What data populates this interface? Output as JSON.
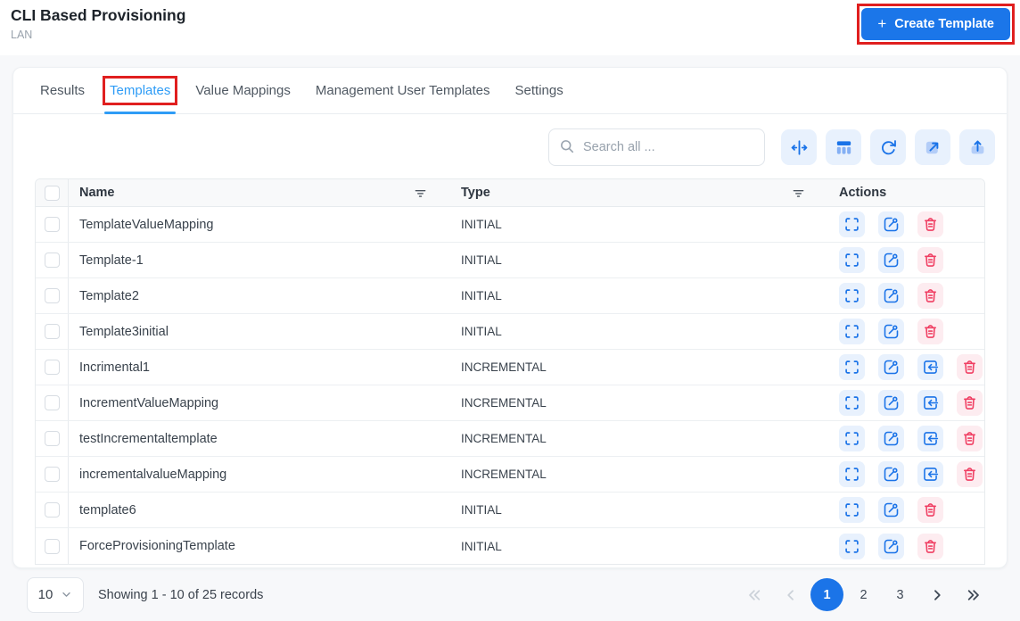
{
  "header": {
    "title": "CLI Based Provisioning",
    "subtitle": "LAN",
    "create_button": {
      "plus": "+",
      "label": "Create Template"
    }
  },
  "tabs": [
    {
      "label": "Results",
      "active": false,
      "annotated": false
    },
    {
      "label": "Templates",
      "active": true,
      "annotated": true
    },
    {
      "label": "Value Mappings",
      "active": false,
      "annotated": false
    },
    {
      "label": "Management User Templates",
      "active": false,
      "annotated": false
    },
    {
      "label": "Settings",
      "active": false,
      "annotated": false
    }
  ],
  "toolbar": {
    "search_placeholder": "Search all ...",
    "buttons": [
      {
        "icon": "column-resize-icon"
      },
      {
        "icon": "columns-icon"
      },
      {
        "icon": "refresh-icon"
      },
      {
        "icon": "open-external-icon"
      },
      {
        "icon": "upload-icon"
      }
    ]
  },
  "table": {
    "headers": {
      "name": "Name",
      "type": "Type",
      "actions": "Actions"
    },
    "rows": [
      {
        "name": "TemplateValueMapping",
        "type": "INITIAL",
        "actions": [
          "expand",
          "edit",
          "delete"
        ]
      },
      {
        "name": "Template-1",
        "type": "INITIAL",
        "actions": [
          "expand",
          "edit",
          "delete"
        ]
      },
      {
        "name": "Template2",
        "type": "INITIAL",
        "actions": [
          "expand",
          "edit",
          "delete"
        ]
      },
      {
        "name": "Template3initial",
        "type": "INITIAL",
        "actions": [
          "expand",
          "edit",
          "delete"
        ]
      },
      {
        "name": "Incrimental1",
        "type": "INCREMENTAL",
        "actions": [
          "expand",
          "edit",
          "import",
          "delete"
        ]
      },
      {
        "name": "IncrementValueMapping",
        "type": "INCREMENTAL",
        "actions": [
          "expand",
          "edit",
          "import",
          "delete"
        ]
      },
      {
        "name": "testIncrementaltemplate",
        "type": "INCREMENTAL",
        "actions": [
          "expand",
          "edit",
          "import",
          "delete"
        ]
      },
      {
        "name": "incrementalvalueMapping",
        "type": "INCREMENTAL",
        "actions": [
          "expand",
          "edit",
          "import",
          "delete"
        ]
      },
      {
        "name": "template6",
        "type": "INITIAL",
        "actions": [
          "expand",
          "edit",
          "delete"
        ]
      },
      {
        "name": "ForceProvisioningTemplate",
        "type": "INITIAL",
        "actions": [
          "expand",
          "edit",
          "delete"
        ]
      }
    ]
  },
  "pagination": {
    "page_size": "10",
    "summary": "Showing 1 - 10 of 25 records",
    "pages": [
      {
        "label": "1",
        "active": true
      },
      {
        "label": "2",
        "active": false
      },
      {
        "label": "3",
        "active": false
      }
    ],
    "controls": {
      "first_disabled": true,
      "prev_disabled": true,
      "next_disabled": false,
      "last_disabled": false
    }
  },
  "colors": {
    "primary_blue": "#1b76e9",
    "tab_active_blue": "#2e9cf6",
    "icon_blue": "#1a73e8",
    "icon_blue_bg": "#e8f1fd",
    "danger_red": "#f03e62",
    "danger_red_bg": "#fdecf0",
    "annotation_red": "#e01f1f"
  }
}
